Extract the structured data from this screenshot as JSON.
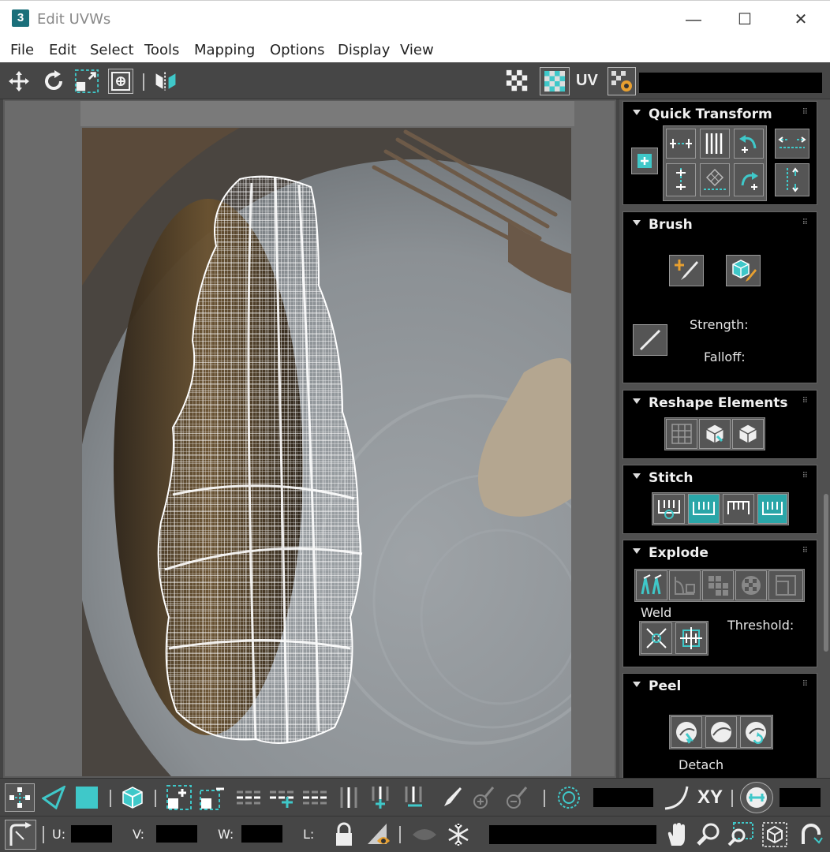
{
  "window": {
    "title": "Edit UVWs",
    "app_icon_text": "3",
    "minimize": "—",
    "maximize": "☐",
    "close": "✕"
  },
  "menu": [
    "File",
    "Edit",
    "Select",
    "Tools",
    "Mapping",
    "Options",
    "Display",
    "View"
  ],
  "toolbar": {
    "uv_label": "UV"
  },
  "panels": {
    "quick_transform": {
      "title": "Quick Transform"
    },
    "brush": {
      "title": "Brush",
      "strength_label": "Strength:",
      "falloff_label": "Falloff:"
    },
    "reshape": {
      "title": "Reshape Elements"
    },
    "stitch": {
      "title": "Stitch"
    },
    "explode": {
      "title": "Explode",
      "weld_label": "Weld",
      "threshold_label": "Threshold:"
    },
    "peel": {
      "title": "Peel",
      "detach_label": "Detach"
    }
  },
  "bottom": {
    "xy_label": "XY",
    "u_label": "U:",
    "v_label": "V:",
    "w_label": "W:",
    "l_label": "L:"
  },
  "colors": {
    "accent": "#39c4c7",
    "panel_bg": "#000000",
    "toolbar_bg": "#464646"
  }
}
